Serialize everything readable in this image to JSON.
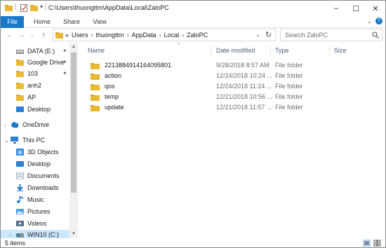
{
  "window": {
    "title_path": "C:\\Users\\thuongttm\\AppData\\Local\\ZaloPC"
  },
  "ribbon": {
    "tabs": [
      "File",
      "Home",
      "Share",
      "View"
    ]
  },
  "address": {
    "breadcrumbs": [
      "Users",
      "thuongttm",
      "AppData",
      "Local",
      "ZaloPC"
    ],
    "overflow_marker": "«"
  },
  "search": {
    "placeholder": "Search ZaloPC"
  },
  "nav_pane": {
    "items": [
      {
        "label": "DATA (E:)",
        "icon": "drive-icon",
        "pinned": true
      },
      {
        "label": "Google Drive",
        "icon": "google-drive-icon",
        "pinned": true
      },
      {
        "label": "103",
        "icon": "folder-icon",
        "pinned": true
      },
      {
        "label": "anh2",
        "icon": "folder-icon",
        "pinned": false
      },
      {
        "label": "AP",
        "icon": "folder-icon",
        "pinned": false
      },
      {
        "label": "Desktop",
        "icon": "desktop-icon",
        "pinned": false
      },
      {
        "label": "OneDrive",
        "icon": "onedrive-icon",
        "pinned": false
      },
      {
        "label": "This PC",
        "icon": "this-pc-icon",
        "pinned": false
      },
      {
        "label": "3D Objects",
        "icon": "3d-objects-icon",
        "pinned": false
      },
      {
        "label": "Desktop",
        "icon": "desktop-icon",
        "pinned": false
      },
      {
        "label": "Documents",
        "icon": "documents-icon",
        "pinned": false
      },
      {
        "label": "Downloads",
        "icon": "downloads-icon",
        "pinned": false
      },
      {
        "label": "Music",
        "icon": "music-icon",
        "pinned": false
      },
      {
        "label": "Pictures",
        "icon": "pictures-icon",
        "pinned": false
      },
      {
        "label": "Videos",
        "icon": "videos-icon",
        "pinned": false
      },
      {
        "label": "WIN10 (C:)",
        "icon": "windows-drive-icon",
        "pinned": false,
        "selected": true
      }
    ]
  },
  "file_list": {
    "columns": [
      "Name",
      "Date modified",
      "Type",
      "Size"
    ],
    "rows": [
      {
        "name": "2213884914164095801",
        "date": "9/28/2018 8:57 AM",
        "type": "File folder",
        "size": ""
      },
      {
        "name": "action",
        "date": "12/24/2018 10:24 ...",
        "type": "File folder",
        "size": ""
      },
      {
        "name": "qos",
        "date": "12/24/2018 11:24 ...",
        "type": "File folder",
        "size": ""
      },
      {
        "name": "temp",
        "date": "12/21/2018 10:56 ...",
        "type": "File folder",
        "size": ""
      },
      {
        "name": "update",
        "date": "12/21/2018 11:57 ...",
        "type": "File folder",
        "size": ""
      }
    ]
  },
  "status": {
    "item_count": "5 items"
  },
  "colors": {
    "file_tab": "#1979ca",
    "folder": "#e8b934",
    "header_text": "#4c607a",
    "selected_nav": "#cce8ff"
  }
}
